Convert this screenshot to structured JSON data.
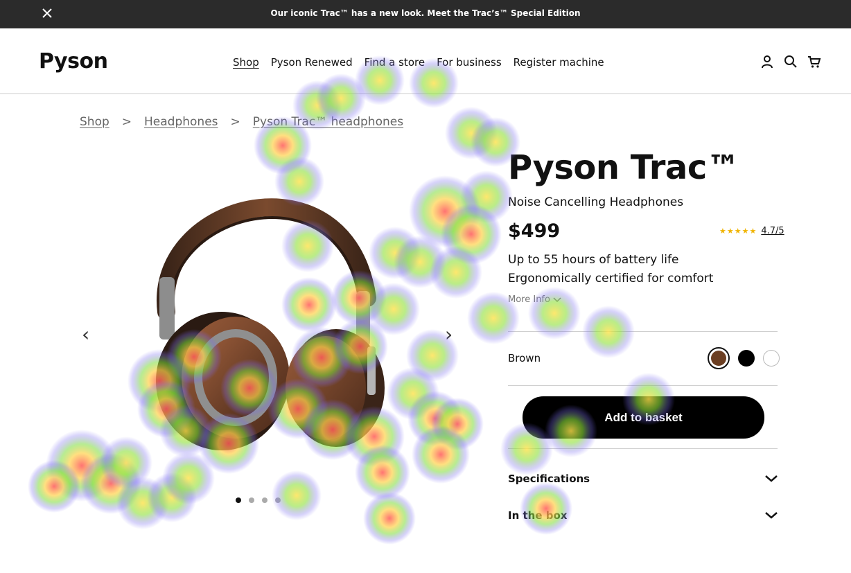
{
  "announcement": {
    "text": "Our iconic Trac™ has a new look. Meet the Trac’s™ Special Edition",
    "close_icon": "close-icon"
  },
  "header": {
    "logo": "Pyson",
    "nav": [
      "Shop",
      "Pyson Renewed",
      "Find a store",
      "For business",
      "Register machine"
    ],
    "active_nav": "Shop",
    "icons": [
      "user-icon",
      "search-icon",
      "cart-icon"
    ]
  },
  "breadcrumb": {
    "items": [
      "Shop",
      "Headphones",
      "Pyson Trac™ headphones"
    ],
    "separator": ">"
  },
  "gallery": {
    "prev": "‹",
    "next": "›",
    "image_count": 4,
    "active_image": 1
  },
  "product": {
    "title": "Pyson Trac™",
    "subtitle": "Noise Cancelling Headphones",
    "price": "$499",
    "stars": "★★★★★",
    "rating": "4.7/5",
    "features": [
      "Up to 55 hours of battery life",
      "Ergonomically certified for comfort"
    ],
    "more_info": "More Info"
  },
  "color": {
    "selected": "Brown",
    "swatches": [
      {
        "name": "brown",
        "hex": "#6b3e22"
      },
      {
        "name": "black",
        "hex": "#000000"
      },
      {
        "name": "white",
        "hex": "#ffffff"
      }
    ]
  },
  "cta": {
    "add_to_basket": "Add to basket"
  },
  "accordions": [
    "Specifications",
    "In the box"
  ],
  "colors": {
    "announcement_bg": "#2b2b2b",
    "cta_bg": "#000000",
    "star": "#f0b400"
  }
}
